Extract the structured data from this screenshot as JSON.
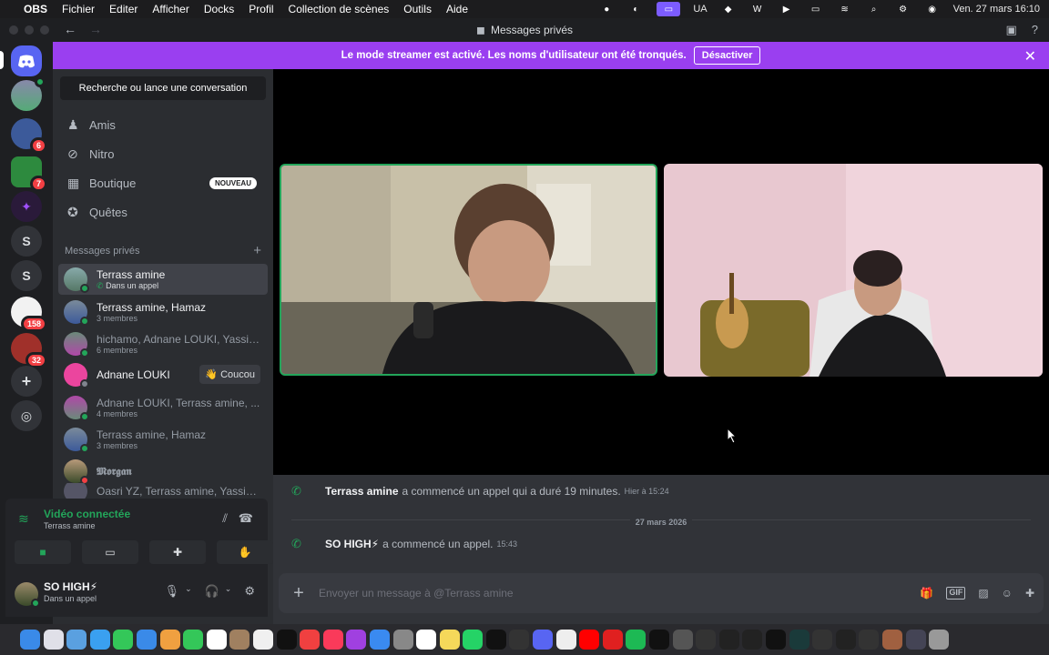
{
  "menubar": {
    "app": "OBS",
    "menus": [
      "Fichier",
      "Editer",
      "Afficher",
      "Docks",
      "Profil",
      "Collection de scènes",
      "Outils",
      "Aide"
    ],
    "keyboard": "UA",
    "datetime": "Ven. 27 mars  16:10"
  },
  "window": {
    "title": "Messages privés"
  },
  "banner": {
    "text": "Le mode streamer est activé. Les noms d'utilisateur ont été tronqués.",
    "button": "Désactiver"
  },
  "guilds": [
    {
      "icon": "discord-home-icon"
    },
    {
      "badge": ""
    },
    {
      "badge": "6"
    },
    {
      "badge": "7"
    },
    {
      "badge": ""
    },
    {
      "letter": "S"
    },
    {
      "letter": "S"
    },
    {
      "badge": "158"
    },
    {
      "badge": "32"
    }
  ],
  "sidebar": {
    "search": "Recherche ou lance une conversation",
    "nav": {
      "friends": "Amis",
      "nitro": "Nitro",
      "shop": "Boutique",
      "shop_badge": "NOUVEAU",
      "quests": "Quêtes"
    },
    "dm_header": "Messages privés",
    "dms": [
      {
        "name": "Terrass amine",
        "sub": "Dans un appel"
      },
      {
        "name": "Terrass amine, Hamaz",
        "sub": "3 membres"
      },
      {
        "name": "hichamo, Adnane LOUKI, Yassin...",
        "sub": "6 membres"
      },
      {
        "name": "Adnane LOUKI",
        "action": "👋 Coucou"
      },
      {
        "name": "Adnane LOUKI, Terrass amine, ...",
        "sub": "4 membres"
      },
      {
        "name": "Terrass amine, Hamaz",
        "sub": "3 membres"
      },
      {
        "name": "𝕸𝖔𝖗𝖌𝖆𝖓"
      },
      {
        "name": "Oasri YZ, Terrass amine, Yassine..."
      }
    ]
  },
  "voice": {
    "status": "Vidéo connectée",
    "channel": "Terrass amine"
  },
  "user": {
    "name": "SO HIGH⚡",
    "status": "Dans un appel"
  },
  "chat": {
    "messages": [
      {
        "author": "Terrass amine",
        "text": "a commencé un appel qui a duré 19 minutes.",
        "time": "Hier à 15:24"
      },
      {
        "author": "SO HIGH⚡",
        "text": "a commencé un appel.",
        "time": "15:43"
      }
    ],
    "date_divider": "27 mars 2026",
    "composer_placeholder": "Envoyer un message à @Terrass amine"
  },
  "colors": {
    "accent": "#9a3ff0",
    "online": "#23a55a",
    "danger": "#f23f43",
    "blurple": "#5865f2"
  }
}
